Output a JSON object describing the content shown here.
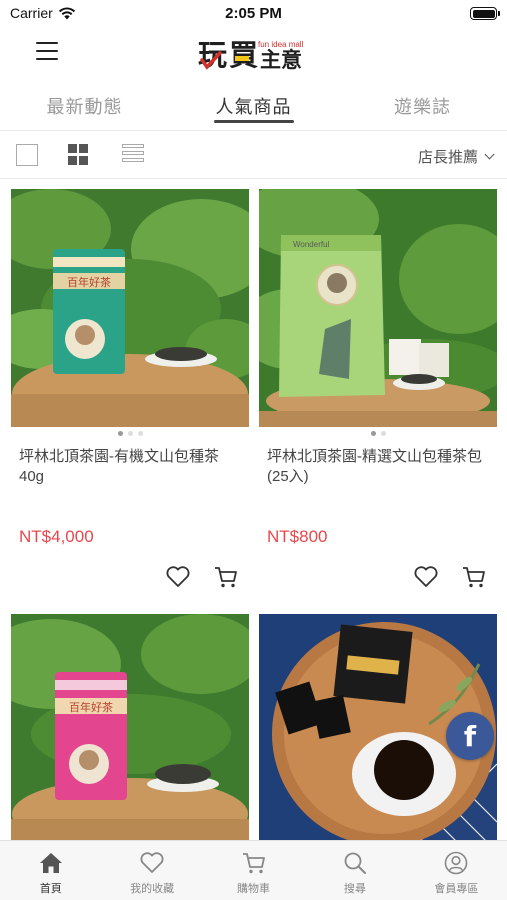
{
  "status_bar": {
    "carrier": "Carrier",
    "time": "2:05 PM"
  },
  "header": {
    "logo_main": "玩買主意",
    "logo_small": "fun idea mall"
  },
  "tabs": [
    {
      "label": "最新動態",
      "active": false
    },
    {
      "label": "人氣商品",
      "active": true
    },
    {
      "label": "遊樂誌",
      "active": false
    }
  ],
  "toolbar": {
    "sort_label": "店長推薦"
  },
  "products": [
    {
      "name": "坪林北頂茶園-有機文山包種茶40g",
      "price": "NT$4,000",
      "package_label": "百年好茶"
    },
    {
      "name": "坪林北頂茶園-精選文山包種茶包(25入)",
      "price": "NT$800",
      "package_label": "Wonderful"
    },
    {
      "name": "",
      "price": "",
      "package_label": "百年好茶"
    },
    {
      "name": "",
      "price": "",
      "package_label": ""
    }
  ],
  "bottom_nav": [
    {
      "label": "首頁",
      "icon": "home-icon",
      "active": true
    },
    {
      "label": "我的收藏",
      "icon": "heart-icon",
      "active": false
    },
    {
      "label": "購物車",
      "icon": "cart-icon",
      "active": false
    },
    {
      "label": "搜尋",
      "icon": "search-icon",
      "active": false
    },
    {
      "label": "會員專區",
      "icon": "user-icon",
      "active": false
    }
  ],
  "floating": {
    "facebook_glyph": "f"
  },
  "colors": {
    "price": "#e8474c",
    "facebook": "#3b5998",
    "logo_red": "#d0312d",
    "logo_yellow": "#f5c518"
  }
}
